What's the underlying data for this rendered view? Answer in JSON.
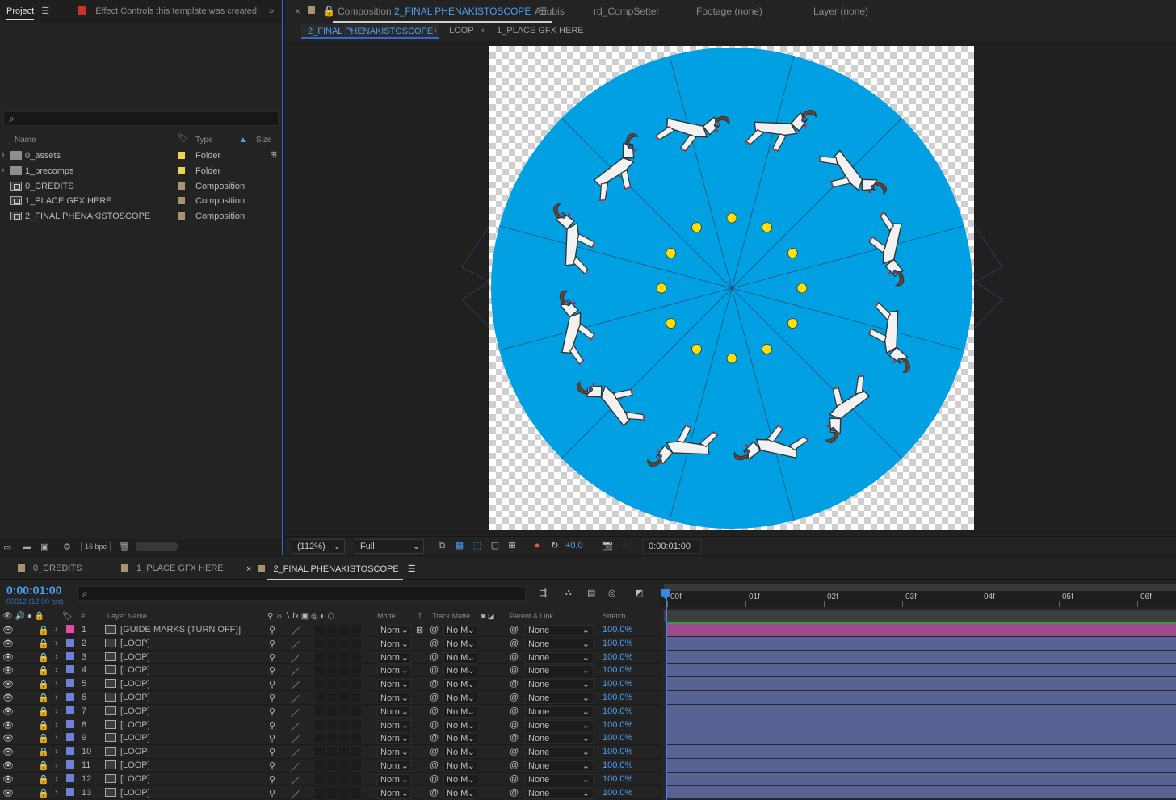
{
  "project_panel": {
    "tab_label": "Project",
    "effect_controls_label": "Effect Controls this template was created",
    "columns": {
      "name": "Name",
      "type": "Type",
      "size": "Size"
    },
    "items": [
      {
        "name": "0_assets",
        "type": "Folder",
        "kind": "folder",
        "color": "#e8d84a"
      },
      {
        "name": "1_precomps",
        "type": "Folder",
        "kind": "folder",
        "color": "#e8d84a"
      },
      {
        "name": "0_CREDITS",
        "type": "Composition",
        "kind": "comp",
        "color": "#a89472"
      },
      {
        "name": "1_PLACE GFX HERE",
        "type": "Composition",
        "kind": "comp",
        "color": "#a89472"
      },
      {
        "name": "2_FINAL PHENAKISTOSCOPE",
        "type": "Composition",
        "kind": "comp",
        "color": "#a89472"
      }
    ],
    "bit_depth": "16 bpc"
  },
  "comp_panel": {
    "tab_prefix": "Composition",
    "tab_comp": "2_FINAL PHENAKISTOSCOPE",
    "other_tabs": [
      "Anubis",
      "rd_CompSetter",
      "Footage (none)",
      "Layer (none)"
    ],
    "breadcrumbs": [
      "2_FINAL PHENAKISTOSCOPE",
      "LOOP",
      "1_PLACE GFX HERE"
    ],
    "viewer": {
      "disc_color": "#00a0e3",
      "dot_color": "#ffe000",
      "segments": 12
    },
    "toolbar": {
      "zoom": "(112%)",
      "resolution": "Full",
      "exposure": "+0.0",
      "timecode": "0:00:01:00"
    }
  },
  "timeline": {
    "tabs": [
      "0_CREDITS",
      "1_PLACE GFX HERE",
      "2_FINAL PHENAKISTOSCOPE"
    ],
    "timecode": "0:00:01:00",
    "fps_label": "00012 (12.00 fps)",
    "columns": {
      "num": "#",
      "layer_name": "Layer Name",
      "mode": "Mode",
      "t": "T",
      "track_matte": "Track Matte",
      "parent": "Parent & Link",
      "stretch": "Stretch"
    },
    "ruler_ticks": [
      "00f",
      "01f",
      "02f",
      "03f",
      "04f",
      "05f",
      "06f"
    ],
    "layers": [
      {
        "num": "1",
        "name": "[GUIDE MARKS (TURN OFF)]",
        "mode": "Norn",
        "matte": "No M",
        "parent": "None",
        "stretch": "100.0%",
        "label_color": "#e24ba6",
        "bar_color": "#9b4b89"
      },
      {
        "num": "2",
        "name": "[LOOP]",
        "mode": "Norn",
        "matte": "No M",
        "parent": "None",
        "stretch": "100.0%",
        "label_color": "#6e80d8",
        "bar_color": "#5a6295"
      },
      {
        "num": "3",
        "name": "[LOOP]",
        "mode": "Norn",
        "matte": "No M",
        "parent": "None",
        "stretch": "100.0%",
        "label_color": "#6e80d8",
        "bar_color": "#5a6295"
      },
      {
        "num": "4",
        "name": "[LOOP]",
        "mode": "Norn",
        "matte": "No M",
        "parent": "None",
        "stretch": "100.0%",
        "label_color": "#6e80d8",
        "bar_color": "#5a6295"
      },
      {
        "num": "5",
        "name": "[LOOP]",
        "mode": "Norn",
        "matte": "No M",
        "parent": "None",
        "stretch": "100.0%",
        "label_color": "#6e80d8",
        "bar_color": "#5a6295"
      },
      {
        "num": "6",
        "name": "[LOOP]",
        "mode": "Norn",
        "matte": "No M",
        "parent": "None",
        "stretch": "100.0%",
        "label_color": "#6e80d8",
        "bar_color": "#5a6295"
      },
      {
        "num": "7",
        "name": "[LOOP]",
        "mode": "Norn",
        "matte": "No M",
        "parent": "None",
        "stretch": "100.0%",
        "label_color": "#6e80d8",
        "bar_color": "#5a6295"
      },
      {
        "num": "8",
        "name": "[LOOP]",
        "mode": "Norn",
        "matte": "No M",
        "parent": "None",
        "stretch": "100.0%",
        "label_color": "#6e80d8",
        "bar_color": "#5a6295"
      },
      {
        "num": "9",
        "name": "[LOOP]",
        "mode": "Norn",
        "matte": "No M",
        "parent": "None",
        "stretch": "100.0%",
        "label_color": "#6e80d8",
        "bar_color": "#5a6295"
      },
      {
        "num": "10",
        "name": "[LOOP]",
        "mode": "Norn",
        "matte": "No M",
        "parent": "None",
        "stretch": "100.0%",
        "label_color": "#6e80d8",
        "bar_color": "#5a6295"
      },
      {
        "num": "11",
        "name": "[LOOP]",
        "mode": "Norn",
        "matte": "No M",
        "parent": "None",
        "stretch": "100.0%",
        "label_color": "#6e80d8",
        "bar_color": "#5a6295"
      },
      {
        "num": "12",
        "name": "[LOOP]",
        "mode": "Norn",
        "matte": "No M",
        "parent": "None",
        "stretch": "100.0%",
        "label_color": "#6e80d8",
        "bar_color": "#5a6295"
      },
      {
        "num": "13",
        "name": "[LOOP]",
        "mode": "Norn",
        "matte": "No M",
        "parent": "None",
        "stretch": "100.0%",
        "label_color": "#6e80d8",
        "bar_color": "#5a6295"
      }
    ]
  }
}
